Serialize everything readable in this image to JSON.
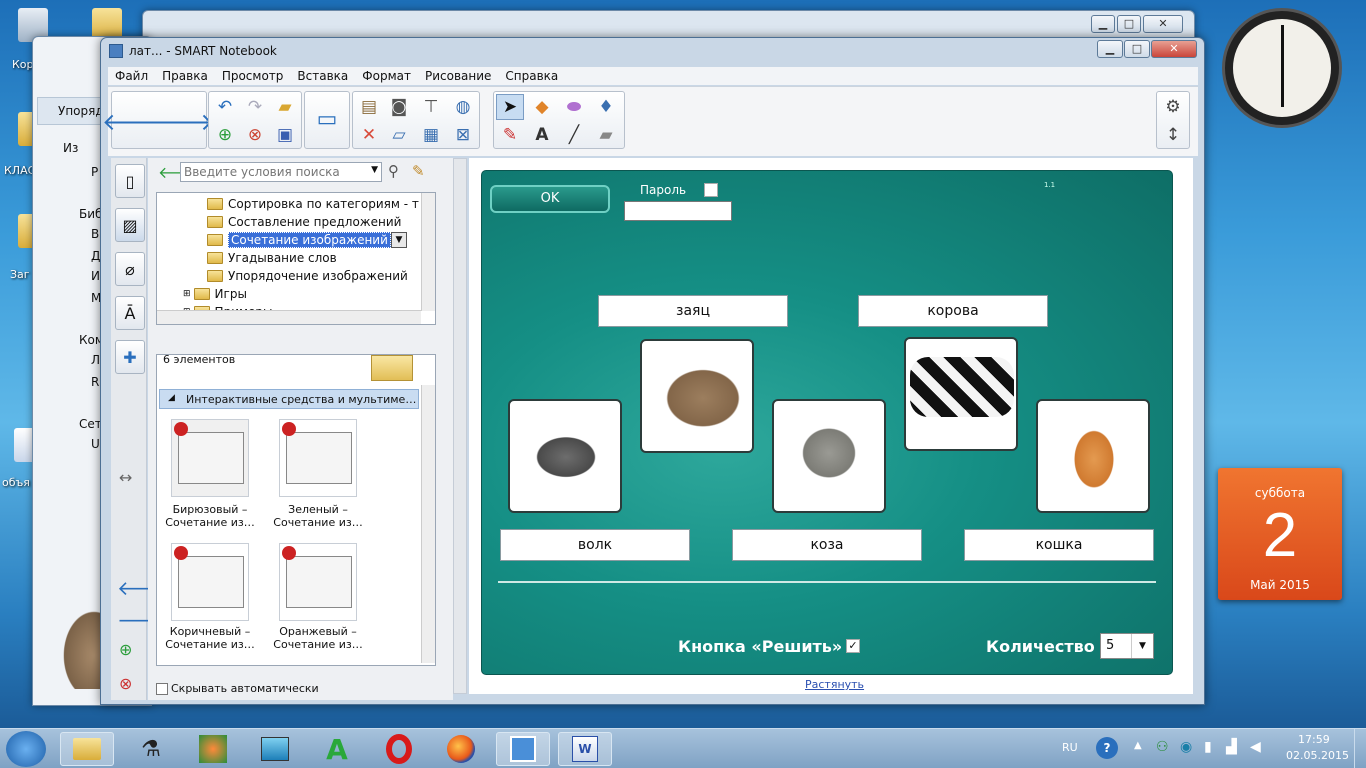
{
  "window": {
    "title": "лат... - SMART Notebook",
    "min": "▁",
    "max": "□",
    "close": "✕"
  },
  "menu": [
    "Файл",
    "Правка",
    "Просмотр",
    "Вставка",
    "Формат",
    "Рисование",
    "Справка"
  ],
  "toolbar": {
    "back_icon": "arrow-left-icon",
    "forward_icon": "arrow-right-icon",
    "buttons": [
      "undo",
      "redo",
      "open",
      "add-page",
      "delete-page",
      "save",
      "screen-shade",
      "paste",
      "screen-capture",
      "insert-table",
      "select",
      "pen",
      "eraser",
      "line",
      "shapes",
      "fill",
      "text",
      "settings"
    ]
  },
  "left_panel_bg": {
    "breadcrumb": "Упорядо",
    "items": [
      "Из",
      "Р",
      "Биб",
      "В",
      "Д",
      "И",
      "М",
      "Ком",
      "Л",
      "R",
      "Сет",
      "U"
    ]
  },
  "desktop": {
    "icons": [
      "Кор",
      "КЛАС",
      "Заг",
      "объя"
    ]
  },
  "gallery": {
    "search_placeholder": "Введите условия поиска",
    "tree": [
      "Сортировка по категориям - т",
      "Составление предложений",
      "Сочетание изображений",
      "Угадывание слов",
      "Упорядочение изображений",
      "Игры",
      "Примеры"
    ],
    "count_label": "6 элементов",
    "section_label": "Интерактивные средства и мультиме…",
    "thumbs": [
      {
        "line1": "Бирюзовый –",
        "line2": "Сочетание из…"
      },
      {
        "line1": "Зеленый –",
        "line2": "Сочетание из…"
      },
      {
        "line1": "Коричневый –",
        "line2": "Сочетание из…"
      },
      {
        "line1": "Оранжевый –",
        "line2": "Сочетание из…"
      }
    ],
    "autohide_label": "Скрывать автоматически"
  },
  "board": {
    "ok_label": "OK",
    "password_label": "Пароль",
    "version_mark": "1.1",
    "words_top": [
      "заяц",
      "корова"
    ],
    "words_bottom": [
      "волк",
      "коза",
      "кошка"
    ],
    "solve_label": "Кнопка «Решить»",
    "count_label": "Количество",
    "count_value": "5",
    "stretch_link": "Растянуть"
  },
  "calendar": {
    "weekday": "суббота",
    "day": "2",
    "month_year": "Май 2015"
  },
  "tray": {
    "lang": "RU",
    "time": "17:59",
    "date": "02.05.2015"
  },
  "colors": {
    "board_teal": "#158f85",
    "calendar_orange": "#e8591a",
    "selection_blue": "#3a6fd8"
  }
}
